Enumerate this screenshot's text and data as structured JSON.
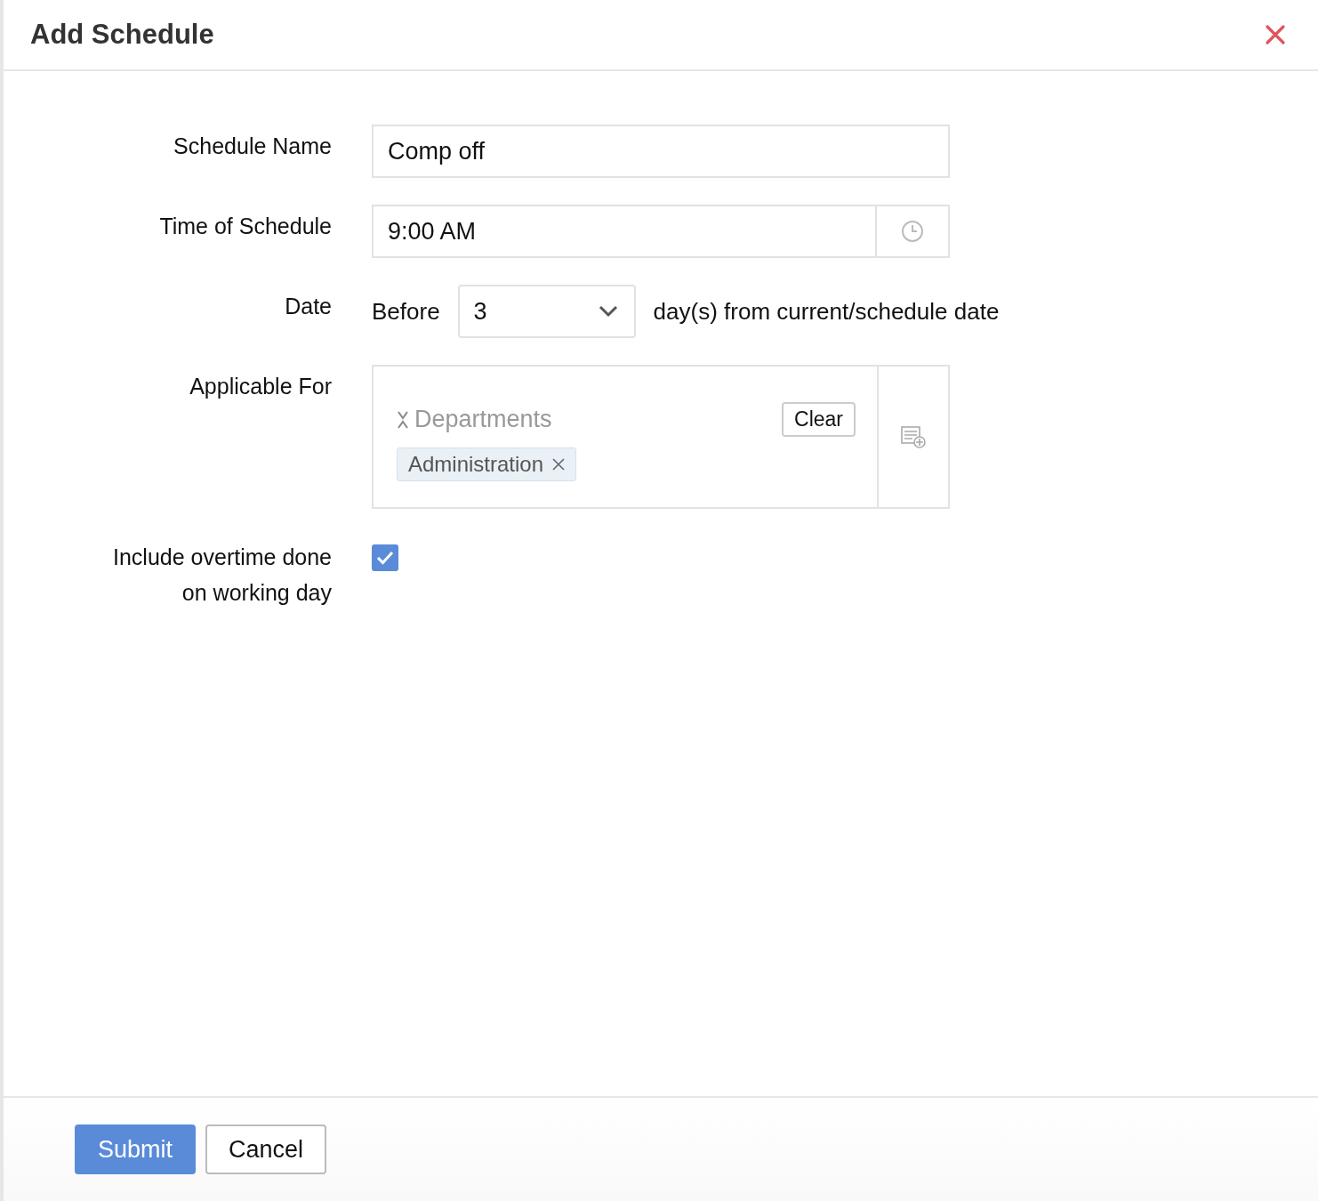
{
  "dialog": {
    "title": "Add Schedule"
  },
  "fields": [
    {
      "kind": "text",
      "label": "Schedule Name",
      "value": "Comp off"
    },
    {
      "kind": "time",
      "label": "Time of Schedule",
      "value": "9:00 AM"
    },
    {
      "kind": "date",
      "label": "Date",
      "prefix": "Before",
      "value": "3",
      "suffix": "day(s) from current/schedule date"
    },
    {
      "kind": "multiselect",
      "label": "Applicable For",
      "group": "Departments",
      "clear_label": "Clear",
      "tags": [
        "Administration"
      ]
    },
    {
      "kind": "checkbox",
      "label": "Include overtime done on working day",
      "checked": true
    }
  ],
  "buttons": [
    {
      "label": "Submit",
      "kind": "primary"
    },
    {
      "label": "Cancel",
      "kind": "secondary"
    }
  ]
}
